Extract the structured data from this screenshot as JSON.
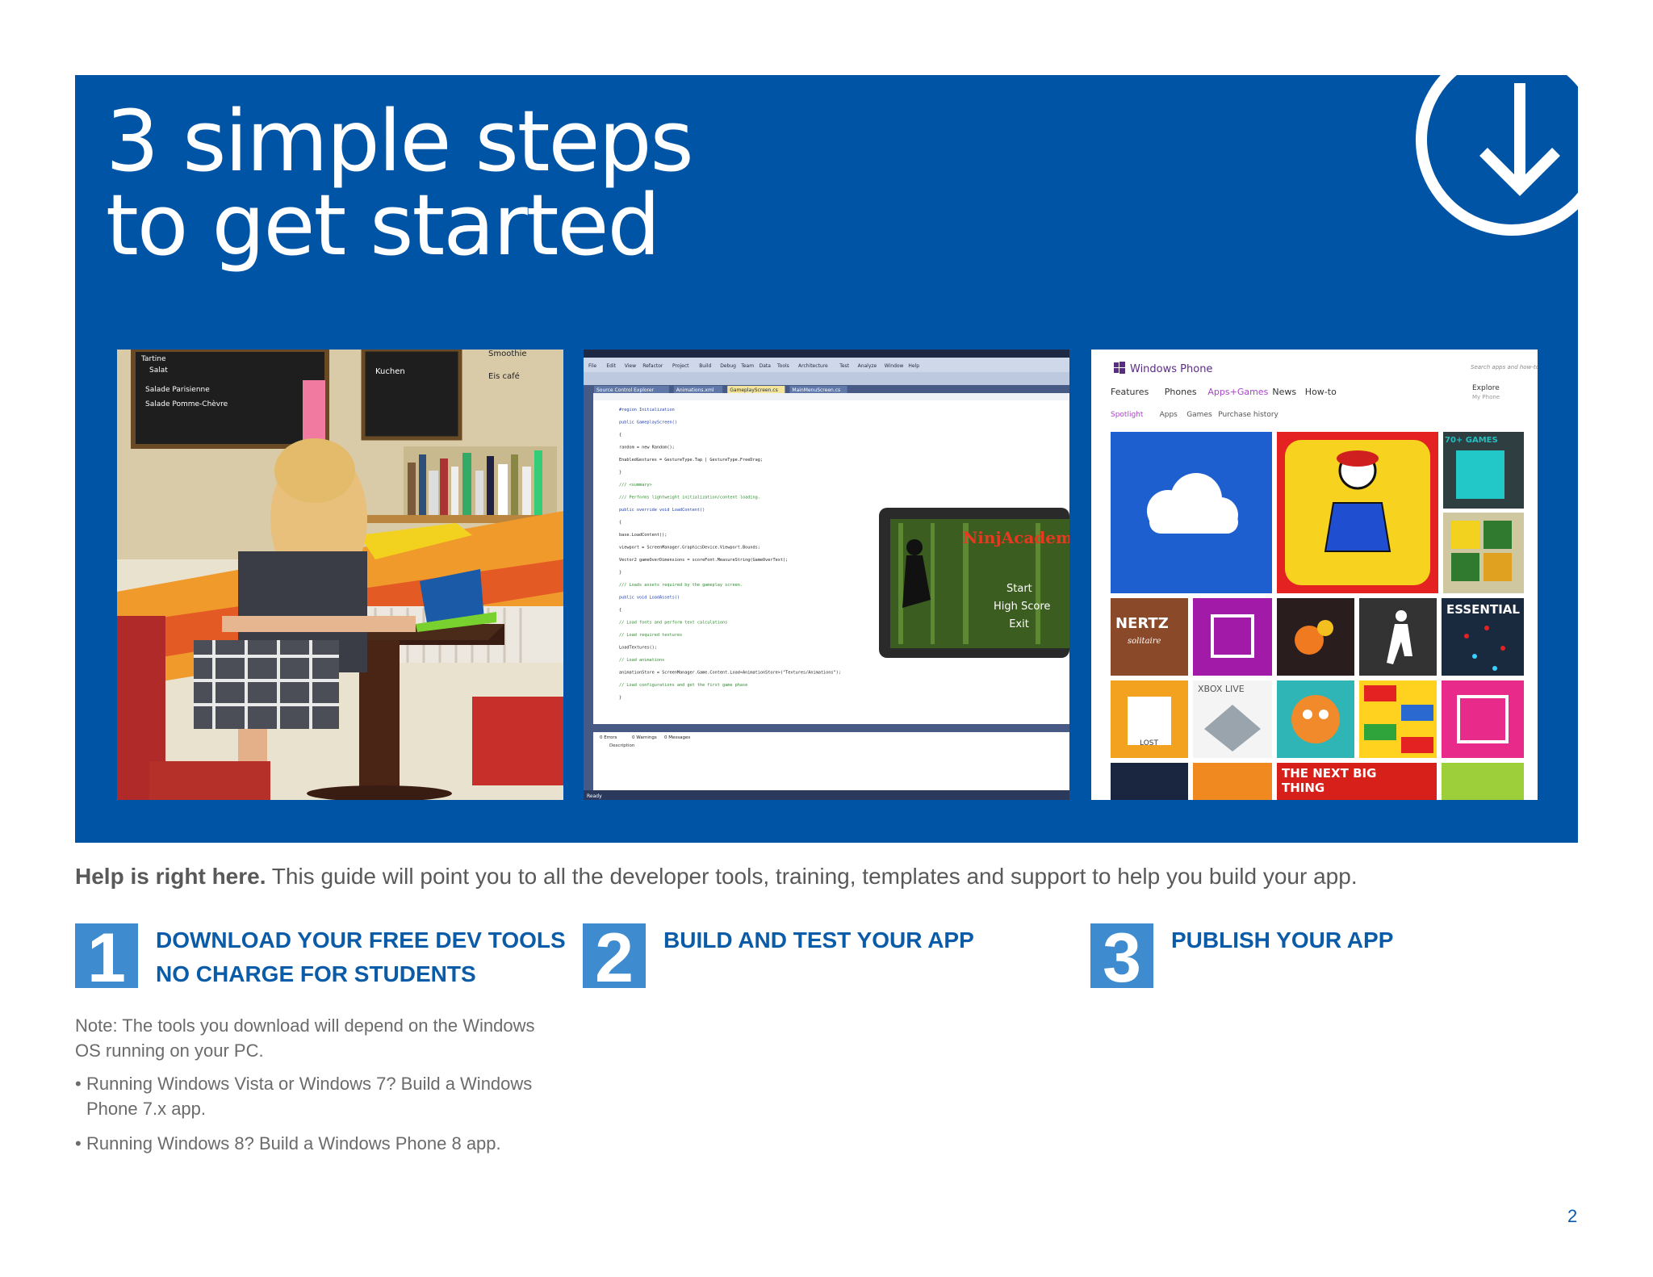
{
  "hero": {
    "title_line1": "3 simple steps",
    "title_line2": "to get started",
    "background": "#0054a6",
    "icon": "down-arrow-circle-icon"
  },
  "screenshots": {
    "photo_board_text": [
      "Tartine",
      "Salat",
      "Salade Parisienne",
      "Salade Pomme-Chèvre",
      "Kuchen",
      "Smoothie",
      "Eis café"
    ],
    "vs": {
      "menu": [
        "File",
        "Edit",
        "View",
        "Refactor",
        "Project",
        "Build",
        "Debug",
        "Team",
        "Data",
        "Tools",
        "Architecture",
        "Test",
        "Analyze",
        "Window",
        "Help"
      ],
      "tabs": [
        "Source Control Explorer",
        "Animations.xml",
        "GameplayScreen.cs",
        "MainMenuScreen.cs"
      ],
      "code_lines": [
        "#region Initialization",
        "public GameplayScreen()",
        "{",
        "    random = new Random();",
        "    EnabledGestures = GestureType.Tap | GestureType.FreeDrag;",
        "}",
        "/// <summary>",
        "/// Performs lightweight initialization/content loading.",
        "public override void LoadContent()",
        "{",
        "    base.LoadContent();",
        "    viewport = ScreenManager.GraphicsDevice.Viewport.Bounds;",
        "    Vector2 gameOverDimensions = scoreFont.MeasureString(GameOverText);",
        "}",
        "/// Loads assets required by the gameplay screen.",
        "public void LoadAssets()",
        "{",
        "    // Load fonts and perform text calculations",
        "    // Load required textures",
        "    LoadTextures();",
        "    // Load animations",
        "    animationStore = ScreenManager.Game.Content.Load<AnimationStore>(\"Textures/Animations\");",
        "    // Load configurations and get the first game phase",
        "}"
      ],
      "game_title": "NinjAcademy",
      "game_menu": [
        "Start",
        "High Score",
        "Exit"
      ],
      "errors": [
        "0 Errors",
        "0 Warnings",
        "0 Messages"
      ],
      "error_header": "Description",
      "status": "Ready"
    },
    "store": {
      "brand": "Windows Phone",
      "search": "Search apps and how-to",
      "nav": [
        "Features",
        "Phones",
        "Apps+Games",
        "News",
        "How-to"
      ],
      "explore": "Explore",
      "explore_sub": "My Phone",
      "subnav": [
        "Spotlight",
        "Apps",
        "Games",
        "Purchase history"
      ],
      "tiles": [
        "70+ GAMES",
        "NERTZ",
        "solitaire",
        "ESSENTIAL",
        "XBOX LIVE",
        "LOST",
        "THE NEXT BIG",
        "THING"
      ]
    }
  },
  "intro": {
    "bold": "Help is right here.",
    "text": " This guide will point you to all the developer tools, training, templates and support to help you build your app."
  },
  "steps": [
    {
      "number": "1",
      "line1": "DOWNLOAD YOUR FREE DEV TOOLS",
      "line2": "NO CHARGE FOR STUDENTS"
    },
    {
      "number": "2",
      "line1": "BUILD AND TEST YOUR APP",
      "line2": ""
    },
    {
      "number": "3",
      "line1": "PUBLISH YOUR APP",
      "line2": ""
    }
  ],
  "note": {
    "lead": "Note:  The tools you download will depend on the Windows OS running on your PC.",
    "bullets": [
      "Running Windows Vista or Windows 7?  Build a Windows Phone 7.x app.",
      "Running Windows 8? Build a Windows Phone 8 app."
    ]
  },
  "page_number": "2",
  "colors": {
    "accent": "#0054a6",
    "heading": "#0a5ba8",
    "step_block": "#3e8bd0",
    "body_text": "#595959"
  }
}
